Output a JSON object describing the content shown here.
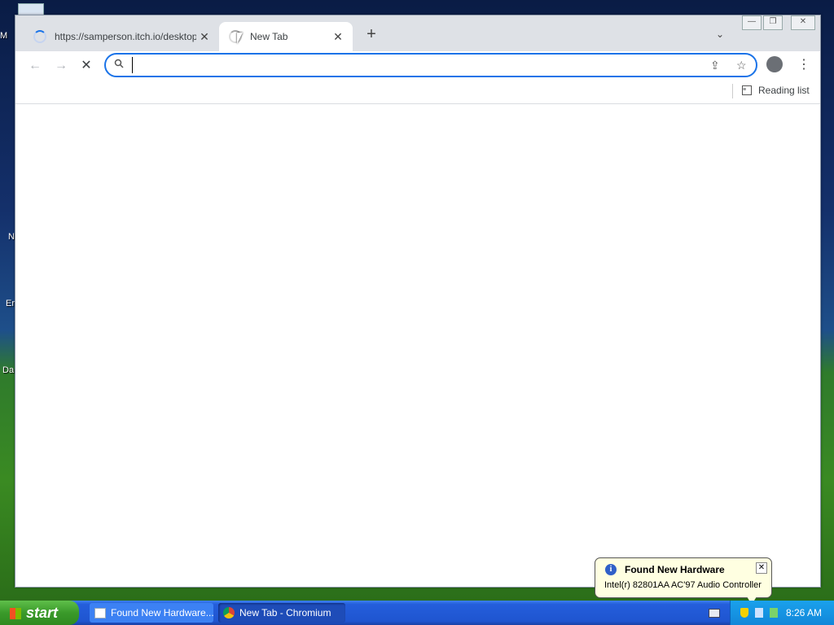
{
  "desktop": {
    "icon_labels": [
      "M",
      "N",
      "Er",
      "Da"
    ]
  },
  "browser": {
    "tabs": [
      {
        "title": "https://samperson.itch.io/desktop-goose",
        "close": "✕"
      },
      {
        "title": "New Tab",
        "close": "✕"
      }
    ],
    "new_tab_glyph": "+",
    "tab_list_glyph": "⌄",
    "window_controls": {
      "minimize": "—",
      "maximize": "❐",
      "close": "✕"
    },
    "toolbar": {
      "back_glyph": "←",
      "forward_glyph": "→",
      "stop_glyph": "✕",
      "omnibox_value": "",
      "share_glyph": "⇪",
      "star_glyph": "☆",
      "menu_glyph": "⋮"
    },
    "reading_list_label": "Reading list"
  },
  "taskbar": {
    "start_label": "start",
    "tasks": [
      {
        "label": "Found New Hardware..."
      },
      {
        "label": "New Tab - Chromium"
      }
    ],
    "clock": "8:26 AM"
  },
  "balloon": {
    "title": "Found New Hardware",
    "text": "Intel(r) 82801AA AC'97 Audio Controller",
    "close": "✕",
    "info_glyph": "i"
  }
}
